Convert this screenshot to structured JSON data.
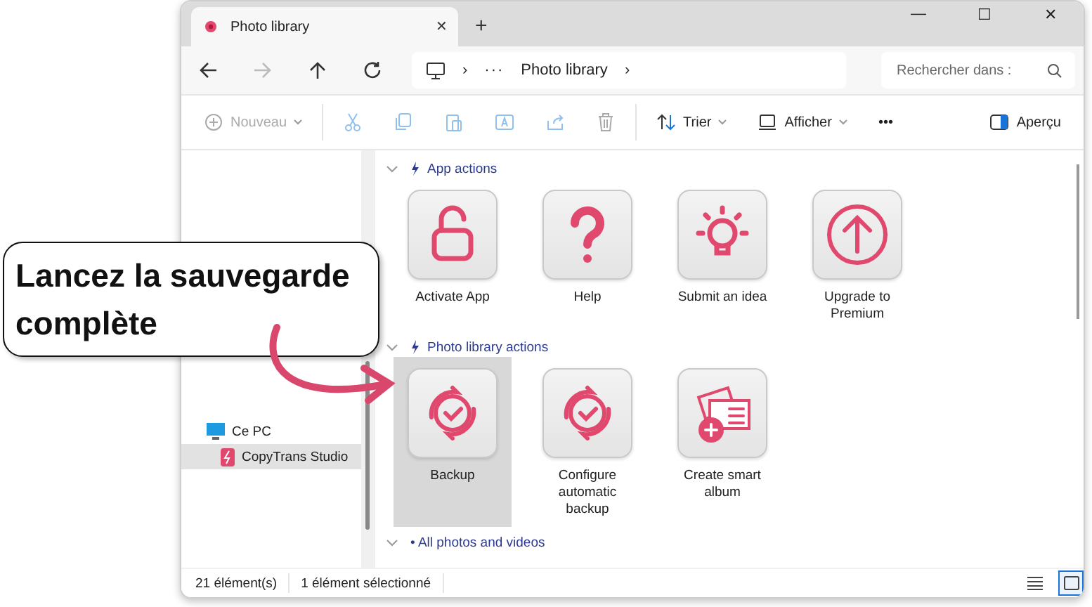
{
  "tab": {
    "title": "Photo library",
    "close": "✕",
    "new_tab": "+"
  },
  "window_controls": [
    "—",
    "☐",
    "✕"
  ],
  "address": {
    "separator": "›",
    "more": "···",
    "location": "Photo library",
    "trail": "›"
  },
  "search": {
    "placeholder": "Rechercher dans :"
  },
  "toolbar": [
    {
      "kind": "new",
      "label": "Nouveau",
      "disabled": true
    },
    {
      "kind": "cut",
      "disabled": true
    },
    {
      "kind": "copy",
      "disabled": true
    },
    {
      "kind": "paste",
      "disabled": true
    },
    {
      "kind": "rename",
      "disabled": true
    },
    {
      "kind": "share",
      "disabled": true
    },
    {
      "kind": "delete",
      "disabled": true
    },
    {
      "kind": "sort",
      "label": "Trier",
      "disabled": false
    },
    {
      "kind": "view",
      "label": "Afficher",
      "disabled": false
    },
    {
      "kind": "more",
      "label": "•••",
      "disabled": false
    }
  ],
  "preview_button": "Aperçu",
  "sidebar": {
    "items": [
      {
        "kind": "pc",
        "label": "Ce PC",
        "selected": false
      },
      {
        "kind": "app",
        "label": "CopyTrans Studio",
        "selected": true
      }
    ]
  },
  "groups": [
    {
      "title": "App actions",
      "expanded": true,
      "items": [
        {
          "kind": "lock",
          "label": "Activate App",
          "selected": false
        },
        {
          "kind": "question",
          "label": "Help",
          "selected": false
        },
        {
          "kind": "bulb",
          "label": "Submit an idea",
          "selected": false
        },
        {
          "kind": "upgrade",
          "label": "Upgrade to Premium",
          "selected": false
        }
      ]
    },
    {
      "title": "Photo library actions",
      "expanded": true,
      "items": [
        {
          "kind": "sync",
          "label": "Backup",
          "selected": true
        },
        {
          "kind": "sync",
          "label": "Configure automatic backup",
          "selected": false
        },
        {
          "kind": "album",
          "label": "Create smart album",
          "selected": false
        }
      ]
    },
    {
      "title": "• All photos and videos",
      "expanded": true
    }
  ],
  "status_bar": {
    "count": "21 élément(s)",
    "selection": "1 élément sélectionné",
    "view_buttons": [
      {
        "kind": "details",
        "selected": false
      },
      {
        "kind": "tiles",
        "selected": true
      }
    ]
  },
  "callout": {
    "text": "Lancez la sauvegarde complète"
  }
}
